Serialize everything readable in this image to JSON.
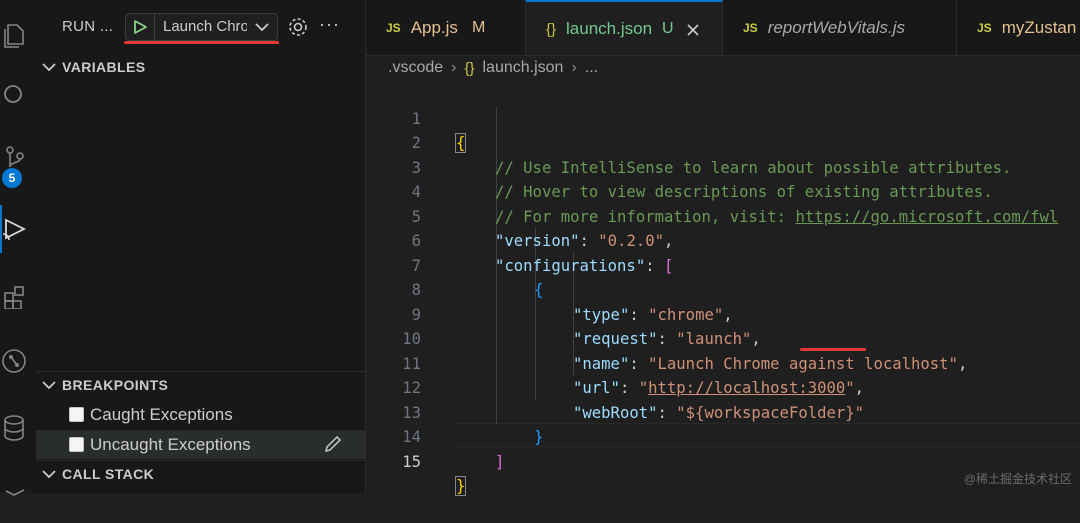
{
  "activity_bar": {
    "icons": [
      "explorer-icon",
      "search-icon",
      "source-control-icon",
      "run-debug-icon",
      "extensions-icon",
      "git-graph-icon",
      "database-icon",
      "remote-icon"
    ],
    "source_control_badge": "5"
  },
  "sidebar": {
    "run_title": "RUN ...",
    "launch_config": "Launch Chrome",
    "sections": {
      "variables": "VARIABLES",
      "breakpoints": "BREAKPOINTS",
      "call_stack": "CALL STACK"
    },
    "breakpoints": [
      {
        "label": "Caught Exceptions",
        "checked": false
      },
      {
        "label": "Uncaught Exceptions",
        "checked": false
      }
    ]
  },
  "tabs": [
    {
      "icon": "JS",
      "label": "App.js",
      "status": "M",
      "active": false
    },
    {
      "icon": "{}",
      "label": "launch.json",
      "status": "U",
      "active": true
    },
    {
      "icon": "JS",
      "label": "reportWebVitals.js",
      "status": "",
      "active": false
    },
    {
      "icon": "JS",
      "label": "myZustan",
      "status": "",
      "active": false
    }
  ],
  "breadcrumb": {
    "folder": ".vscode",
    "file_icon": "{}",
    "file": "launch.json",
    "tail": "..."
  },
  "editor": {
    "line_numbers": [
      "1",
      "2",
      "3",
      "4",
      "5",
      "6",
      "7",
      "8",
      "9",
      "10",
      "11",
      "12",
      "13",
      "14",
      "15"
    ],
    "lines": {
      "l1": "{",
      "l2": "// Use IntelliSense to learn about possible attributes.",
      "l3": "// Hover to view descriptions of existing attributes.",
      "l4_prefix": "// For more information, visit: ",
      "l4_link": "https://go.microsoft.com/fwl",
      "l5_key": "\"version\"",
      "l5_val": "\"0.2.0\"",
      "l6_key": "\"configurations\"",
      "l6_open": "[",
      "l7": "{",
      "l8_key": "\"type\"",
      "l8_val": "\"chrome\"",
      "l9_key": "\"request\"",
      "l9_val": "\"launch\"",
      "l10_key": "\"name\"",
      "l10_val": "\"Launch Chrome against localhost\"",
      "l11_key": "\"url\"",
      "l11_q1": "\"",
      "l11_link": "http://localhost:3000",
      "l11_q2": "\"",
      "l12_key": "\"webRoot\"",
      "l12_val": "\"${workspaceFolder}\"",
      "l13": "}",
      "l14": "]",
      "l15": "}"
    }
  },
  "watermark": "@稀土掘金技术社区",
  "colors": {
    "accent": "#0078d4",
    "annotation_red": "#e53935"
  }
}
